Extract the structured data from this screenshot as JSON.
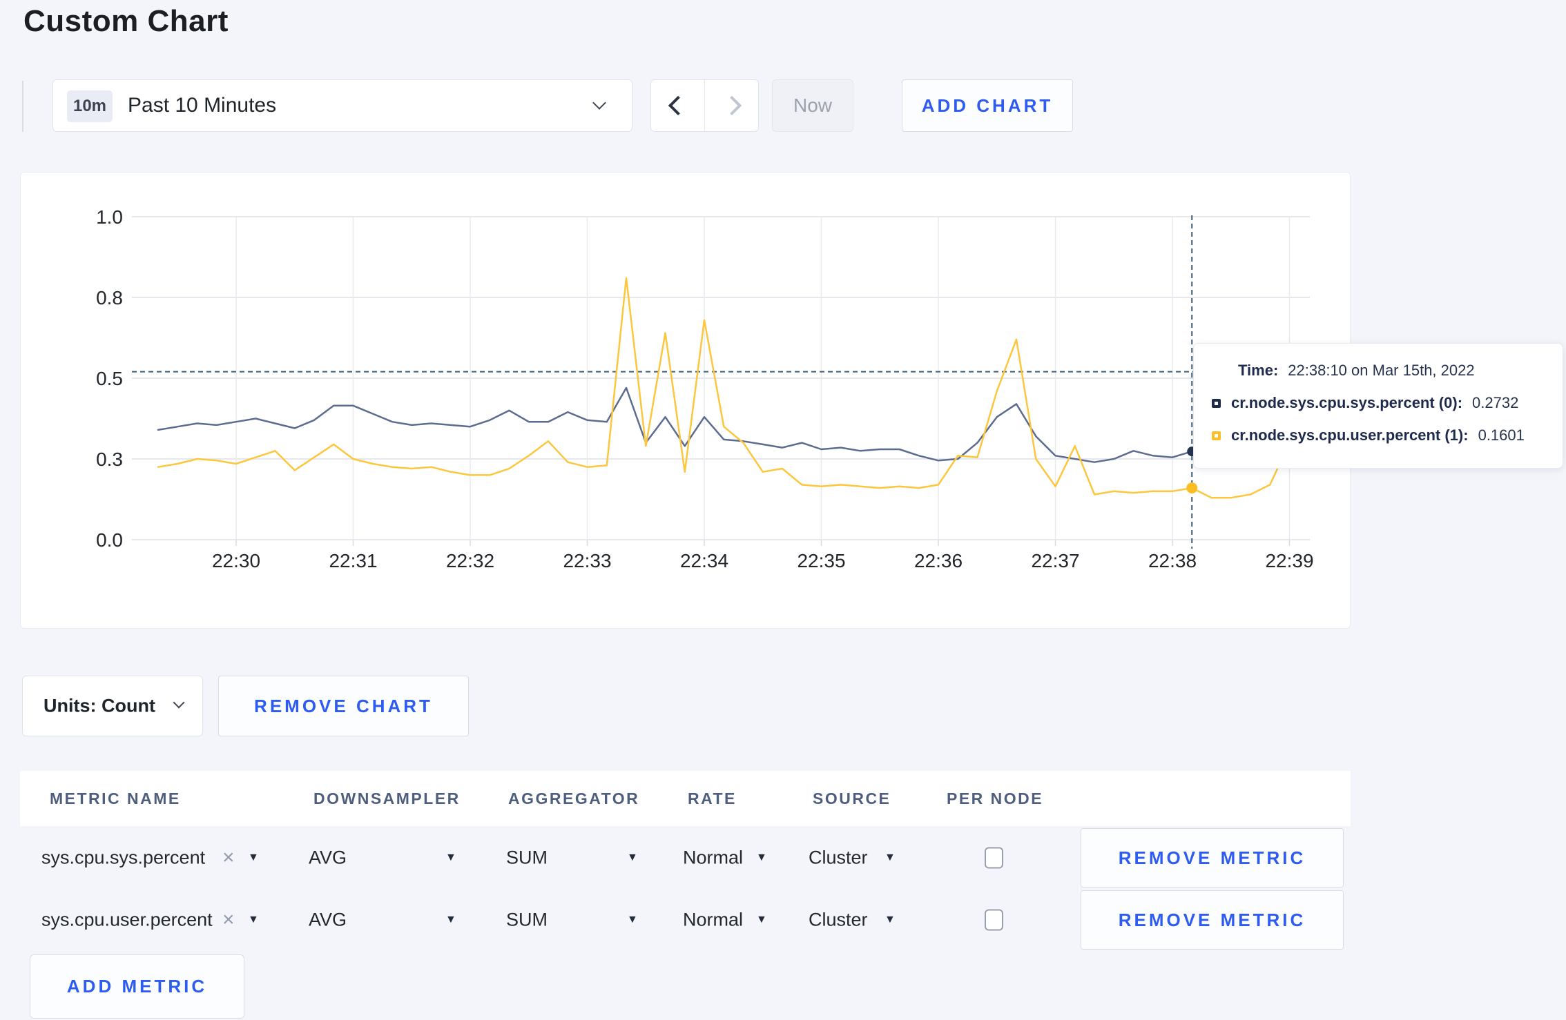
{
  "title": "Custom Chart",
  "toolbar": {
    "time_window_badge": "10m",
    "time_window_label": "Past 10 Minutes",
    "now_label": "Now",
    "add_chart_label": "ADD CHART",
    "icons": {
      "dropdown": "chevron-down",
      "prev": "chevron-left",
      "next": "chevron-right"
    }
  },
  "chart": {
    "tooltip": {
      "time_label": "Time:",
      "time_value": "22:38:10 on Mar 15th, 2022",
      "rows": [
        {
          "label": "cr.node.sys.cpu.sys.percent (0):",
          "value": "0.2732",
          "swatch": "#1c2b4a"
        },
        {
          "label": "cr.node.sys.cpu.user.percent (1):",
          "value": "0.1601",
          "swatch": "#fcbf28"
        }
      ]
    }
  },
  "chart_data": {
    "type": "line",
    "title": "",
    "xlabel": "",
    "ylabel": "",
    "ylim": [
      0,
      1
    ],
    "grid": true,
    "legend_position": "tooltip",
    "y_tick_labels": [
      "0.0",
      "0.3",
      "0.5",
      "0.8",
      "1.0"
    ],
    "y_tick_values": [
      0,
      0.25,
      0.5,
      0.75,
      1
    ],
    "x_tick_labels": [
      "22:30",
      "22:31",
      "22:32",
      "22:33",
      "22:34",
      "22:35",
      "22:36",
      "22:37",
      "22:38",
      "22:39"
    ],
    "x_times": [
      "22:29:20",
      "22:29:30",
      "22:29:40",
      "22:29:50",
      "22:30:00",
      "22:30:10",
      "22:30:20",
      "22:30:30",
      "22:30:40",
      "22:30:50",
      "22:31:00",
      "22:31:10",
      "22:31:20",
      "22:31:30",
      "22:31:40",
      "22:31:50",
      "22:32:00",
      "22:32:10",
      "22:32:20",
      "22:32:30",
      "22:32:40",
      "22:32:50",
      "22:33:00",
      "22:33:10",
      "22:33:20",
      "22:33:30",
      "22:33:40",
      "22:33:50",
      "22:34:00",
      "22:34:10",
      "22:34:20",
      "22:34:30",
      "22:34:40",
      "22:34:50",
      "22:35:00",
      "22:35:10",
      "22:35:20",
      "22:35:30",
      "22:35:40",
      "22:35:50",
      "22:36:00",
      "22:36:10",
      "22:36:20",
      "22:36:30",
      "22:36:40",
      "22:36:50",
      "22:37:00",
      "22:37:10",
      "22:37:20",
      "22:37:30",
      "22:37:40",
      "22:37:50",
      "22:38:00",
      "22:38:10",
      "22:38:20",
      "22:38:30",
      "22:38:40",
      "22:38:50",
      "22:39:00",
      "22:39:10"
    ],
    "series": [
      {
        "name": "cr.node.sys.cpu.sys.percent",
        "color": "#5c6b8f",
        "values": [
          0.34,
          0.35,
          0.36,
          0.355,
          0.365,
          0.375,
          0.36,
          0.345,
          0.37,
          0.415,
          0.415,
          0.39,
          0.365,
          0.355,
          0.36,
          0.355,
          0.35,
          0.37,
          0.4,
          0.365,
          0.365,
          0.395,
          0.37,
          0.365,
          0.47,
          0.3,
          0.38,
          0.29,
          0.38,
          0.31,
          0.305,
          0.295,
          0.285,
          0.3,
          0.28,
          0.285,
          0.275,
          0.28,
          0.28,
          0.26,
          0.245,
          0.25,
          0.3,
          0.38,
          0.42,
          0.32,
          0.26,
          0.25,
          0.24,
          0.25,
          0.275,
          0.26,
          0.255,
          0.2732,
          0.26,
          0.28,
          0.26,
          0.255,
          0.27,
          0.265
        ]
      },
      {
        "name": "cr.node.sys.cpu.user.percent",
        "color": "#fcc63d",
        "values": [
          0.225,
          0.235,
          0.25,
          0.245,
          0.235,
          0.255,
          0.275,
          0.215,
          0.255,
          0.295,
          0.25,
          0.235,
          0.225,
          0.22,
          0.225,
          0.21,
          0.2,
          0.2,
          0.22,
          0.26,
          0.305,
          0.24,
          0.225,
          0.23,
          0.81,
          0.29,
          0.64,
          0.21,
          0.68,
          0.35,
          0.3,
          0.21,
          0.22,
          0.17,
          0.165,
          0.17,
          0.165,
          0.16,
          0.165,
          0.16,
          0.17,
          0.26,
          0.255,
          0.46,
          0.62,
          0.25,
          0.165,
          0.29,
          0.14,
          0.15,
          0.145,
          0.15,
          0.15,
          0.1601,
          0.13,
          0.13,
          0.14,
          0.17,
          0.3,
          0.24
        ]
      }
    ],
    "crosshair": {
      "time": "22:38:10",
      "y_value": 0.52
    },
    "hover_points": [
      {
        "series": 0,
        "time": "22:38:10",
        "value": 0.2732
      },
      {
        "series": 1,
        "time": "22:38:10",
        "value": 0.1601
      }
    ]
  },
  "footer": {
    "units_label": "Units: Count",
    "remove_chart_label": "REMOVE CHART"
  },
  "metrics_table": {
    "headers": {
      "metric_name": "METRIC NAME",
      "downsampler": "DOWNSAMPLER",
      "aggregator": "AGGREGATOR",
      "rate": "RATE",
      "source": "SOURCE",
      "per_node": "PER NODE"
    },
    "rows": [
      {
        "metric": "sys.cpu.sys.percent",
        "clear": "×",
        "downsampler": "AVG",
        "aggregator": "SUM",
        "rate": "Normal",
        "source": "Cluster",
        "per_node_checked": false,
        "remove_label": "REMOVE METRIC"
      },
      {
        "metric": "sys.cpu.user.percent",
        "clear": "×",
        "downsampler": "AVG",
        "aggregator": "SUM",
        "rate": "Normal",
        "source": "Cluster",
        "per_node_checked": false,
        "remove_label": "REMOVE METRIC"
      }
    ],
    "add_metric_label": "ADD METRIC"
  },
  "colors": {
    "accent_blue": "#2e5bf0",
    "series_sys": "#5c6b8f",
    "series_user": "#fcc63d",
    "crosshair": "#3f5d77",
    "page_bg": "#f4f5fa"
  }
}
